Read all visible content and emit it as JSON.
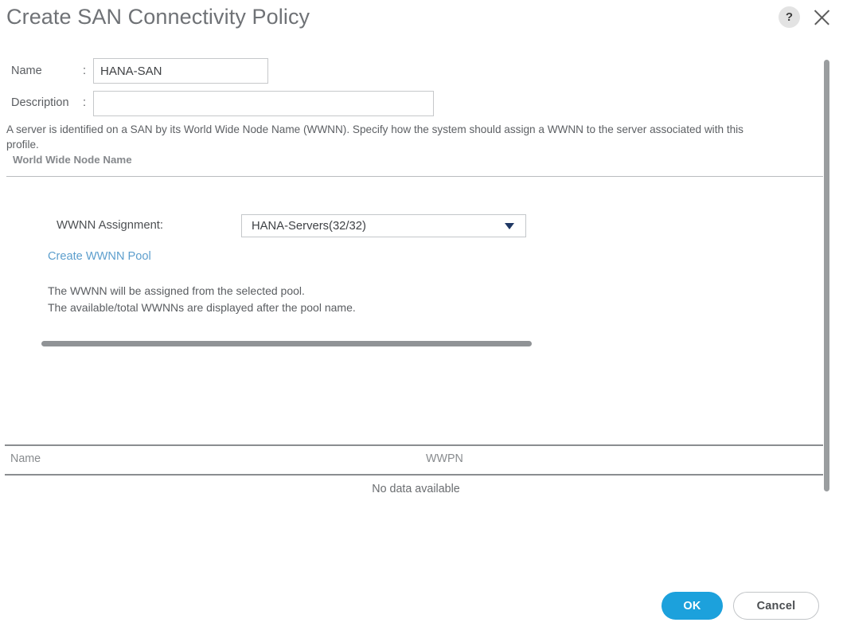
{
  "header": {
    "title": "Create SAN Connectivity Policy",
    "help_icon": "question-mark-icon",
    "help_label": "?",
    "close_icon": "close-icon"
  },
  "form": {
    "name": {
      "label": "Name",
      "separator": ":",
      "value": "HANA-SAN",
      "placeholder": ""
    },
    "description": {
      "label": "Description",
      "separator": ":",
      "value": "",
      "placeholder": ""
    }
  },
  "intro_text": "A server is identified on a SAN by its World Wide Node Name (WWNN). Specify how the system should assign a WWNN to the server associated with this profile.",
  "section": {
    "label": "World Wide Node Name"
  },
  "assignment": {
    "label": "WWNN Assignment:",
    "selected": "HANA-Servers(32/32)",
    "options": [
      "HANA-Servers(32/32)"
    ],
    "arrow_icon": "chevron-down-icon",
    "create_pool_link": "Create WWNN Pool",
    "hint": "The WWNN will be assigned from the selected pool.\nThe available/total WWNNs are displayed after the pool name."
  },
  "table": {
    "columns": [
      "Name",
      "WWPN"
    ],
    "rows": [],
    "empty_message": "No data available"
  },
  "footer": {
    "ok_label": "OK",
    "cancel_label": "Cancel"
  },
  "colors": {
    "accent_blue": "#1ca1dc",
    "link_blue": "#5c9ecd",
    "dropdown_arrow": "#1f3864",
    "title_gray": "#6f7276",
    "scrollbar_gray": "#9a9d9f"
  },
  "scrollbars": {
    "vertical": "vertical-scrollbar",
    "horizontal": "horizontal-scrollbar"
  }
}
